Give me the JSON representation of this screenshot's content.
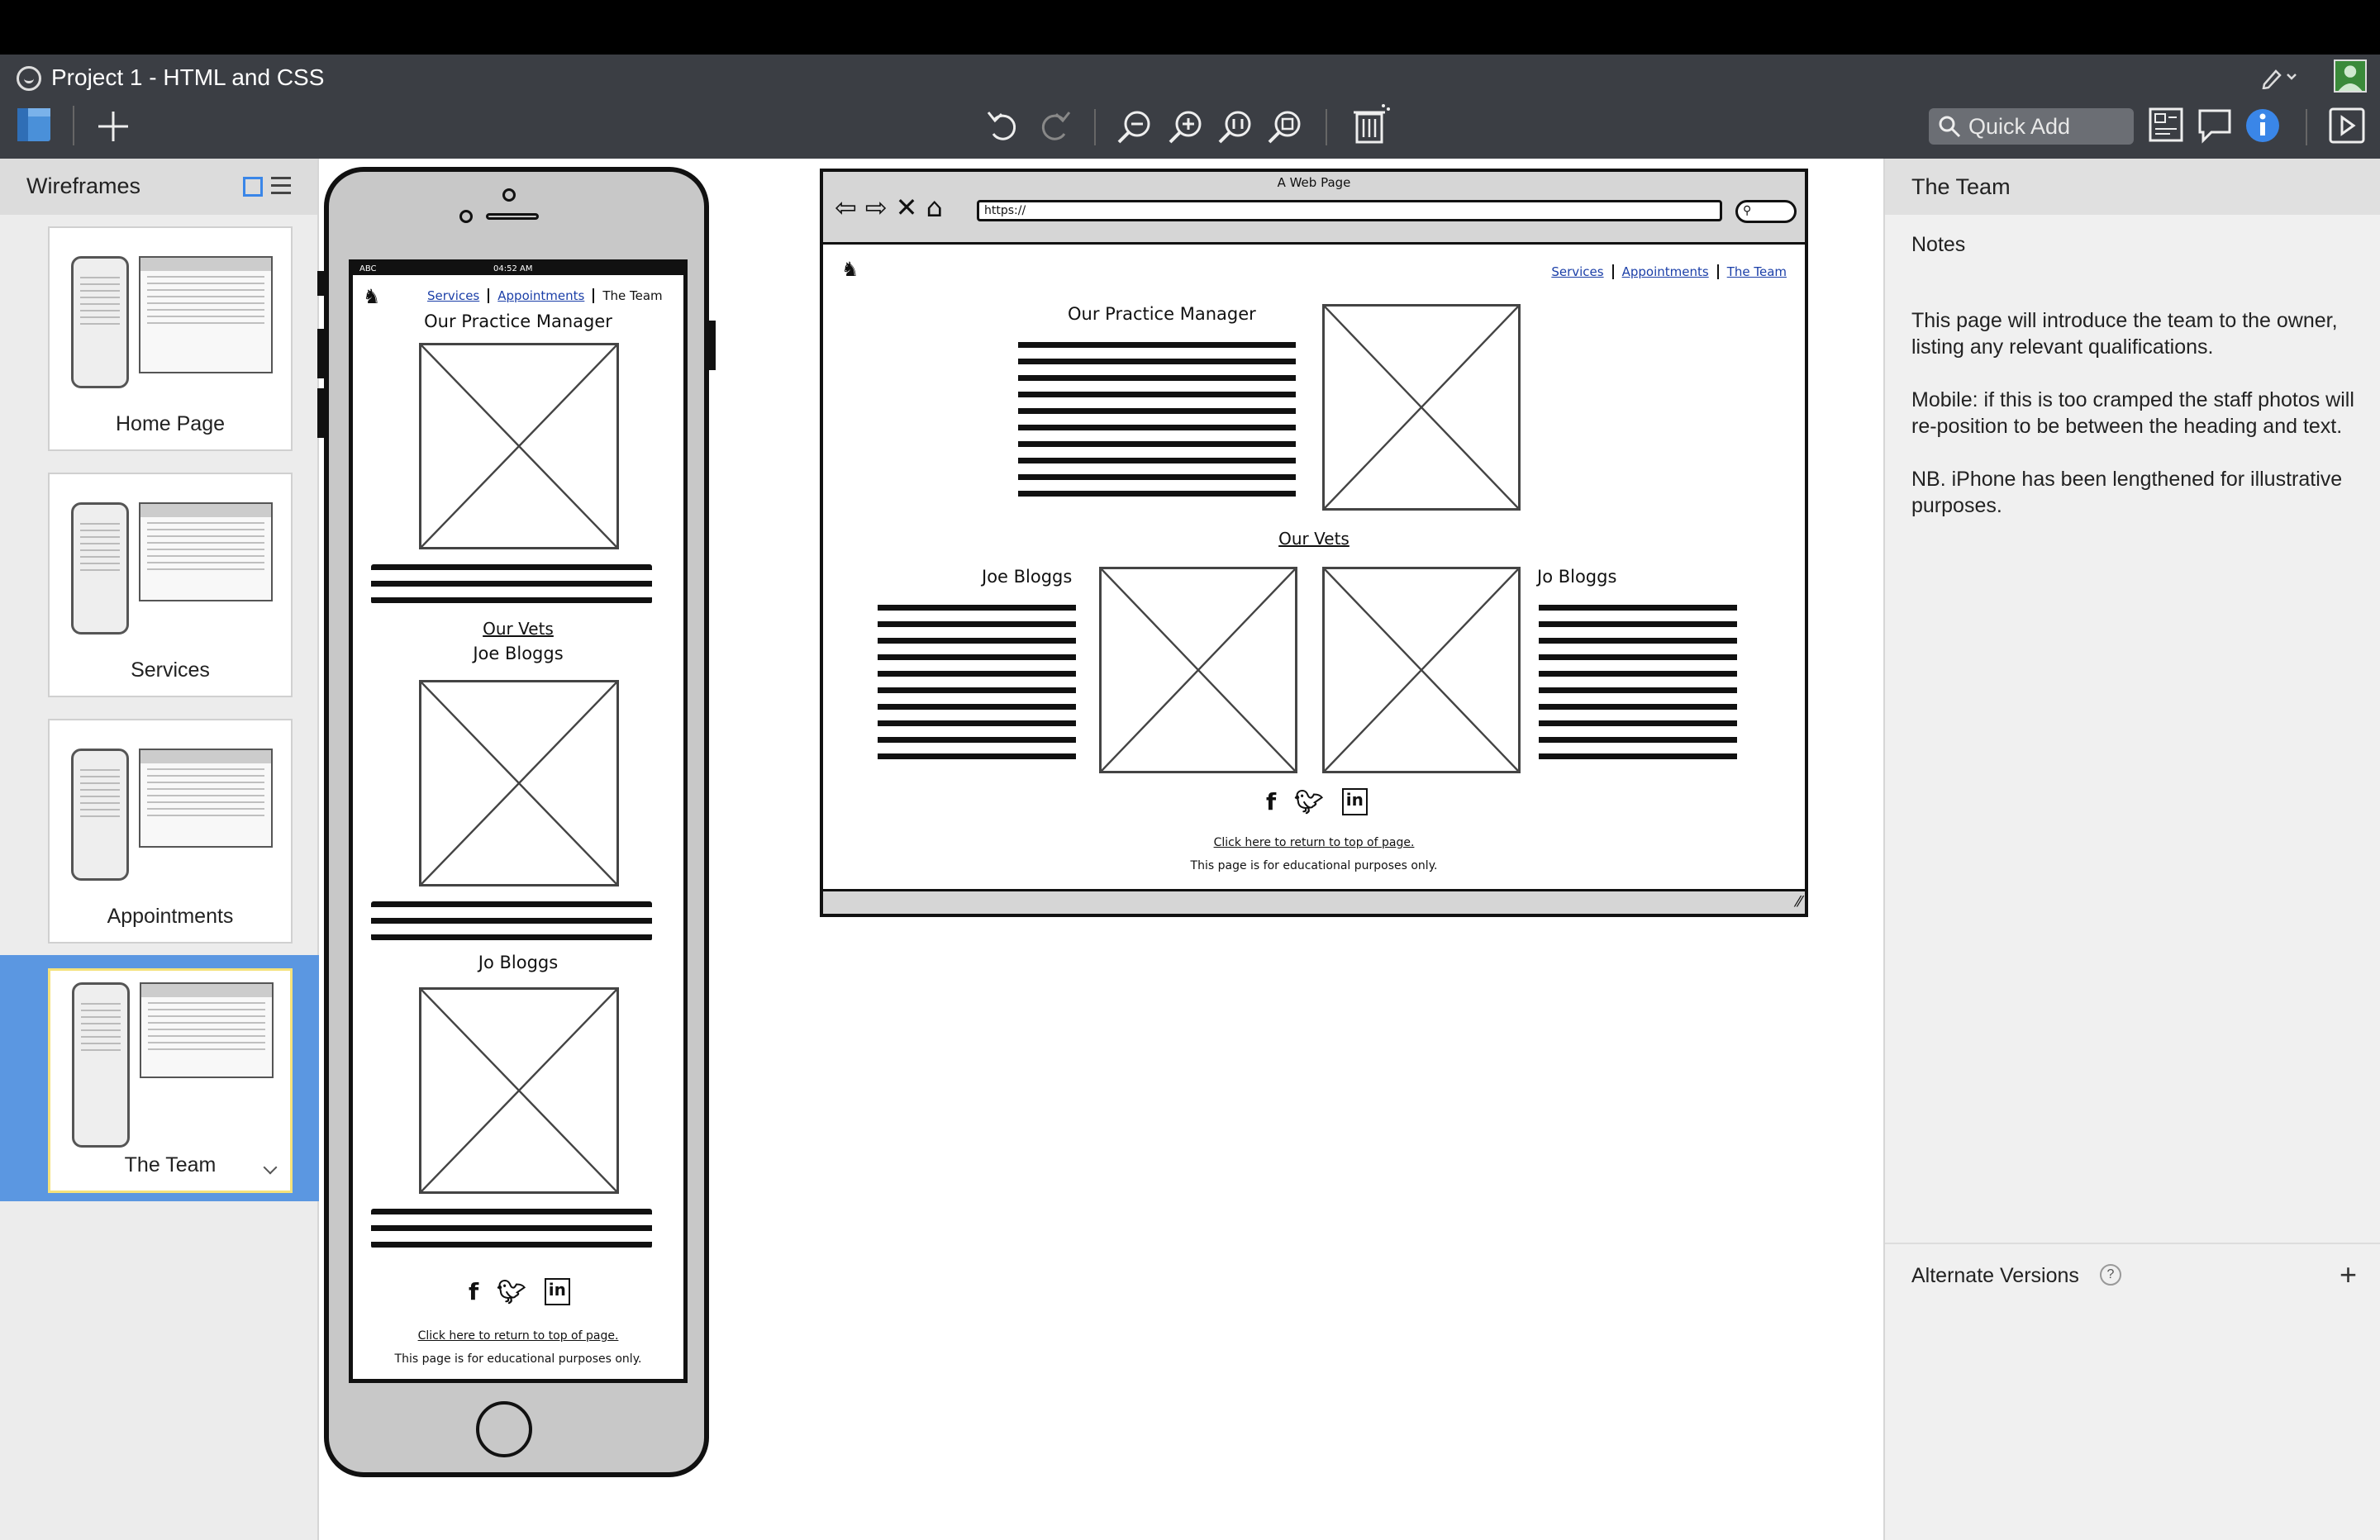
{
  "window": {
    "title": "Project 1 - HTML and CSS"
  },
  "toolbar": {
    "quick_add_placeholder": "Quick Add"
  },
  "sidebar": {
    "title": "Wireframes",
    "items": [
      {
        "label": "Home Page"
      },
      {
        "label": "Services"
      },
      {
        "label": "Appointments"
      },
      {
        "label": "The Team"
      }
    ]
  },
  "mobile": {
    "status_carrier": "ABC",
    "status_time": "04:52 AM",
    "nav": {
      "services": "Services",
      "appointments": "Appointments",
      "team": "The Team"
    },
    "manager_heading": "Our Practice Manager",
    "vets_heading": "Our Vets",
    "vet1_name": "Joe Bloggs",
    "vet2_name": "Jo Bloggs",
    "return_link": "Click here to return to top of page.",
    "footer_note": "This page is for educational purposes only."
  },
  "desktop": {
    "window_title": "A Web Page",
    "url": "https://",
    "nav": {
      "services": "Services",
      "appointments": "Appointments",
      "team": "The Team"
    },
    "manager_heading": "Our Practice Manager",
    "vets_heading": "Our Vets",
    "vet1_name": "Joe Bloggs",
    "vet2_name": "Jo Bloggs",
    "return_link": "Click here to return to top of page.",
    "footer_note": "This page is for educational purposes only."
  },
  "panel": {
    "title": "The Team",
    "notes_label": "Notes",
    "notes_text": "This page will introduce the team to the owner, listing any relevant qualifications.\n\nMobile: if this is too cramped the staff photos will re-position to be between the heading and text.\n\nNB. iPhone has been lengthened for illustrative purposes.",
    "alternate_versions": "Alternate Versions",
    "help_glyph": "?",
    "add_glyph": "+"
  },
  "colors": {
    "selection": "#5b97e1",
    "titlebar": "#3b3e44",
    "info_blue": "#3a86e8"
  }
}
